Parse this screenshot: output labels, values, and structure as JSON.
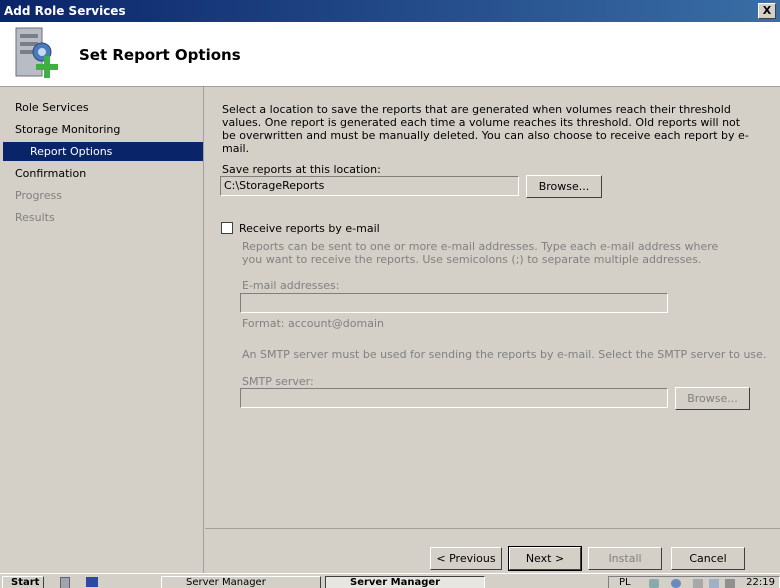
{
  "window": {
    "title": "Add Role Services",
    "close_glyph": "X"
  },
  "header": {
    "title": "Set Report Options",
    "icon": "server-add-icon"
  },
  "sidebar": {
    "items": [
      {
        "label": "Role Services",
        "state": "normal"
      },
      {
        "label": "Storage Monitoring",
        "state": "normal"
      },
      {
        "label": "Report Options",
        "state": "active"
      },
      {
        "label": "Confirmation",
        "state": "normal"
      },
      {
        "label": "Progress",
        "state": "disabled"
      },
      {
        "label": "Results",
        "state": "disabled"
      }
    ],
    "active_color": "#0a246a"
  },
  "main": {
    "description": "Select a location to save the reports that are generated when volumes reach their threshold values. One report is generated each time a volume reaches its threshold. Old reports will not be overwritten and must be manually deleted. You can also choose to receive each report by e-mail.",
    "save_location_label": "Save reports at this location:",
    "save_location_value": "C:\\StorageReports",
    "browse_label": "Browse...",
    "email_checkbox_label": "Receive reports by e-mail",
    "email_checkbox_checked": false,
    "email_help": "Reports can be sent to one or more e-mail addresses. Type each e-mail address where you want to receive the reports. Use semicolons (;) to separate multiple addresses.",
    "email_addresses_label": "E-mail addresses:",
    "email_addresses_value": "",
    "email_format_hint": "Format: account@domain",
    "smtp_help": "An SMTP server must be used for sending the reports by e-mail. Select the SMTP server to use.",
    "smtp_label": "SMTP server:",
    "smtp_value": "",
    "smtp_browse_label": "Browse..."
  },
  "footer": {
    "previous_label": "< Previous",
    "next_label": "Next >",
    "install_label": "Install",
    "cancel_label": "Cancel"
  },
  "taskbar": {
    "start_label": "Start",
    "items": [
      {
        "label": "Server Manager",
        "pressed": false
      },
      {
        "label": "Server Manager",
        "pressed": true
      }
    ],
    "tray_lang": "PL",
    "clock": "22:19"
  }
}
